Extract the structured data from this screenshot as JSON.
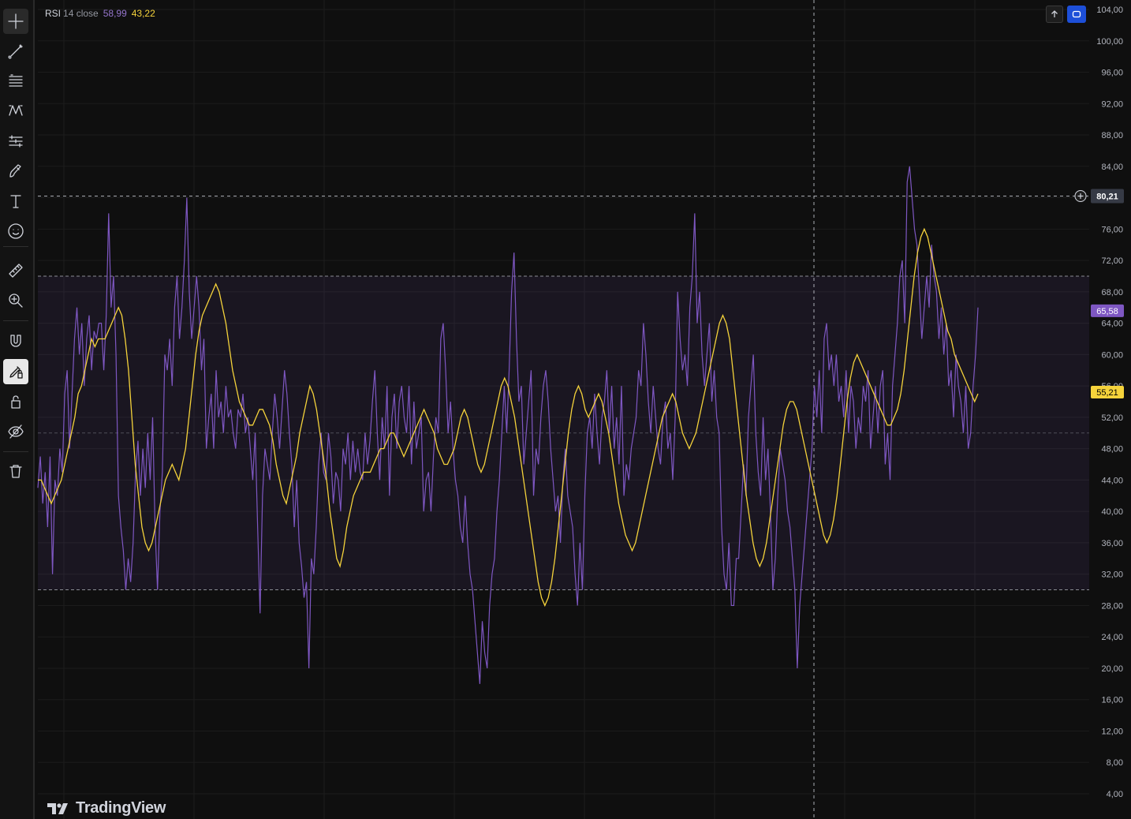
{
  "legend": {
    "name": "RSI",
    "params": "14 close",
    "rsi_value": "58,99",
    "ma_value": "43,22"
  },
  "logo": {
    "text": "TradingView"
  },
  "toolbar": {
    "icons": [
      "crosshair-icon",
      "trend-line-icon",
      "fib-retracement-icon",
      "pattern-icon",
      "prediction-icon",
      "brush-icon",
      "text-icon",
      "emoji-icon",
      "ruler-icon",
      "zoom-in-icon",
      "magnet-icon",
      "lock-drawing-icon",
      "lock-icon",
      "eye-icon",
      "trash-icon"
    ]
  },
  "colors": {
    "rsi": "#7e57c2",
    "ma": "#f5d33b",
    "band": "#7e57c2",
    "background": "#0f0f0f"
  },
  "chart_data": {
    "type": "line",
    "ylim": [
      2,
      105
    ],
    "y_ticks": [
      "104,00",
      "100,00",
      "96,00",
      "92,00",
      "88,00",
      "84,00",
      "80,00",
      "76,00",
      "72,00",
      "68,00",
      "64,00",
      "60,00",
      "56,00",
      "52,00",
      "48,00",
      "44,00",
      "40,00",
      "36,00",
      "32,00",
      "28,00",
      "24,00",
      "20,00",
      "16,00",
      "12,00",
      "8,00",
      "4,00"
    ],
    "levels": {
      "upper": 70,
      "middle": 50,
      "lower": 30
    },
    "crosshair_price": "80,21",
    "last_labels": {
      "rsi": "65,58",
      "ma": "55,21"
    },
    "series": [
      {
        "values": [
          43,
          47,
          41,
          45,
          38,
          47,
          32,
          44,
          42,
          48,
          45,
          55,
          58,
          48,
          55,
          62,
          66,
          60,
          64,
          56,
          62,
          65,
          58,
          63,
          62,
          64,
          64,
          58,
          65,
          78,
          66,
          70,
          60,
          42,
          38,
          35,
          30,
          34,
          31,
          36,
          45,
          49,
          42,
          48,
          43,
          50,
          44,
          52,
          38,
          30,
          40,
          45,
          60,
          58,
          62,
          56,
          66,
          70,
          62,
          66,
          72,
          80,
          68,
          62,
          66,
          70,
          66,
          58,
          62,
          48,
          52,
          55,
          48,
          58,
          52,
          54,
          50,
          56,
          52,
          53,
          50,
          48,
          53,
          52,
          55,
          50,
          52,
          48,
          44,
          50,
          38,
          27,
          42,
          48,
          46,
          44,
          50,
          55,
          52,
          48,
          53,
          58,
          55,
          50,
          46,
          38,
          44,
          36,
          33,
          29,
          31,
          20,
          34,
          32,
          38,
          46,
          50,
          45,
          44,
          50,
          47,
          41,
          45,
          44,
          40,
          48,
          46,
          50,
          44,
          49,
          45,
          48,
          45,
          44,
          50,
          46,
          49,
          54,
          58,
          50,
          44,
          52,
          48,
          56,
          42,
          52,
          55,
          48,
          54,
          56,
          52,
          50,
          56,
          46,
          54,
          48,
          50,
          52,
          40,
          44,
          45,
          40,
          47,
          52,
          50,
          62,
          64,
          58,
          50,
          54,
          48,
          44,
          42,
          38,
          36,
          42,
          36,
          32,
          30,
          26,
          22,
          18,
          26,
          22,
          20,
          28,
          32,
          34,
          40,
          44,
          50,
          56,
          50,
          58,
          68,
          73,
          62,
          54,
          56,
          46,
          50,
          54,
          58,
          42,
          48,
          46,
          52,
          56,
          58,
          54,
          48,
          44,
          40,
          42,
          36,
          44,
          48,
          42,
          40,
          38,
          32,
          28,
          36,
          30,
          42,
          50,
          52,
          48,
          55,
          50,
          46,
          52,
          54,
          58,
          50,
          56,
          48,
          52,
          46,
          56,
          42,
          46,
          44,
          48,
          50,
          52,
          58,
          56,
          64,
          60,
          54,
          50,
          56,
          52,
          48,
          46,
          52,
          54,
          48,
          50,
          44,
          52,
          68,
          62,
          58,
          60,
          56,
          66,
          70,
          78,
          64,
          68,
          60,
          56,
          60,
          64,
          54,
          58,
          52,
          50,
          38,
          32,
          30,
          36,
          28,
          28,
          34,
          34,
          40,
          46,
          42,
          52,
          56,
          60,
          50,
          45,
          42,
          52,
          44,
          48,
          40,
          30,
          34,
          42,
          48,
          46,
          44,
          40,
          38,
          34,
          30,
          20,
          28,
          32,
          36,
          40,
          44,
          48,
          56,
          52,
          58,
          50,
          62,
          64,
          58,
          60,
          56,
          60,
          54,
          56,
          52,
          58,
          50,
          56,
          54,
          48,
          52,
          50,
          56,
          54,
          58,
          48,
          52,
          56,
          50,
          56,
          58,
          46,
          50,
          44,
          56,
          60,
          64,
          70,
          72,
          64,
          82,
          84,
          80,
          76,
          74,
          68,
          62,
          66,
          70,
          66,
          74,
          70,
          68,
          62,
          66,
          60,
          64,
          56,
          58,
          52,
          60,
          56,
          54,
          50,
          56,
          48,
          50,
          56,
          60,
          66
        ]
      },
      {
        "values": [
          44,
          44,
          43,
          42,
          41,
          42,
          43,
          44,
          46,
          48,
          50,
          52,
          55,
          56,
          58,
          60,
          62,
          61,
          62,
          62,
          62,
          63,
          64,
          65,
          66,
          65,
          62,
          58,
          52,
          46,
          42,
          38,
          36,
          35,
          36,
          38,
          40,
          42,
          44,
          45,
          46,
          45,
          44,
          46,
          48,
          52,
          56,
          60,
          63,
          65,
          66,
          67,
          68,
          69,
          68,
          66,
          64,
          61,
          58,
          56,
          54,
          53,
          52,
          51,
          51,
          52,
          53,
          53,
          52,
          51,
          49,
          46,
          44,
          42,
          41,
          43,
          45,
          47,
          50,
          52,
          54,
          56,
          55,
          53,
          50,
          47,
          44,
          40,
          37,
          34,
          33,
          35,
          38,
          40,
          42,
          43,
          44,
          45,
          45,
          45,
          46,
          47,
          48,
          48,
          49,
          50,
          50,
          49,
          48,
          47,
          48,
          49,
          50,
          51,
          52,
          53,
          52,
          51,
          50,
          48,
          47,
          46,
          46,
          47,
          48,
          50,
          52,
          53,
          52,
          50,
          48,
          46,
          45,
          46,
          48,
          50,
          52,
          54,
          56,
          57,
          56,
          54,
          52,
          49,
          46,
          43,
          40,
          37,
          34,
          31,
          29,
          28,
          29,
          31,
          34,
          38,
          42,
          46,
          50,
          53,
          55,
          56,
          55,
          53,
          52,
          53,
          54,
          55,
          54,
          52,
          50,
          47,
          44,
          41,
          39,
          37,
          36,
          35,
          36,
          38,
          40,
          42,
          44,
          46,
          48,
          50,
          52,
          53,
          54,
          55,
          54,
          52,
          50,
          49,
          48,
          49,
          50,
          52,
          54,
          56,
          58,
          60,
          62,
          64,
          65,
          64,
          62,
          58,
          54,
          50,
          46,
          42,
          39,
          36,
          34,
          33,
          34,
          36,
          39,
          42,
          45,
          48,
          51,
          53,
          54,
          54,
          53,
          51,
          49,
          47,
          45,
          43,
          41,
          39,
          37,
          36,
          37,
          39,
          42,
          46,
          50,
          54,
          57,
          59,
          60,
          59,
          58,
          57,
          56,
          55,
          54,
          53,
          52,
          51,
          51,
          52,
          53,
          55,
          58,
          62,
          66,
          70,
          73,
          75,
          76,
          75,
          73,
          71,
          69,
          67,
          65,
          63,
          62,
          60,
          59,
          58,
          57,
          56,
          55,
          54,
          55
        ]
      }
    ]
  }
}
